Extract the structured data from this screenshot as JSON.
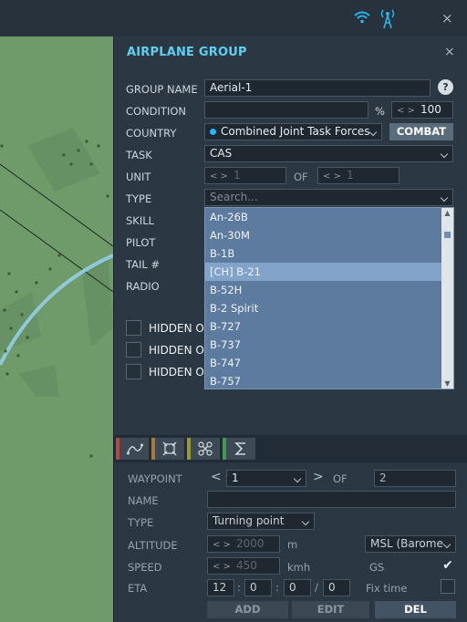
{
  "topbar": {
    "wifi_icon": "wifi-icon",
    "tower_icon": "tower-icon",
    "close": "×"
  },
  "panel": {
    "title": "AIRPLANE GROUP",
    "close": "×",
    "group_name_label": "GROUP NAME",
    "group_name_value": "Aerial-1",
    "help": "?",
    "condition_label": "CONDITION",
    "condition_value": "",
    "percent": "%",
    "condition_count": "100",
    "country_label": "COUNTRY",
    "country_value": "Combined Joint Task Forces",
    "combat_button": "COMBAT",
    "task_label": "TASK",
    "task_value": "CAS",
    "unit_label": "UNIT",
    "unit_value": "1",
    "of_label": "OF",
    "unit_of_value": "1",
    "type_label": "TYPE",
    "type_placeholder": "Search...",
    "skill_label": "SKILL",
    "pilot_label": "PILOT",
    "tail_label": "TAIL #",
    "radio_label": "RADIO",
    "type_options": [
      "An-26B",
      "An-30M",
      "B-1B",
      "[CH] B-21",
      "B-52H",
      "B-2 Spirit",
      "B-727",
      "B-737",
      "B-747",
      "B-757"
    ],
    "type_selected_index": 3,
    "hidden_labels": [
      "HIDDEN ON",
      "HIDDEN ON",
      "HIDDEN ON"
    ]
  },
  "waypoint": {
    "tabs": [
      {
        "icon": "route-icon",
        "color": "#b5473c"
      },
      {
        "icon": "target-icon",
        "color": "#a87c36"
      },
      {
        "icon": "drone-icon",
        "color": "#9a9a34"
      },
      {
        "icon": "sigma-icon",
        "color": "#3f9a52"
      }
    ],
    "waypoint_label": "WAYPOINT",
    "waypoint_value": "1",
    "of_label": "OF",
    "of_value": "2",
    "name_label": "NAME",
    "name_value": "",
    "type_label": "TYPE",
    "type_value": "Turning point",
    "altitude_label": "ALTITUDE",
    "altitude_value": "2000",
    "altitude_unit": "m",
    "altitude_ref": "MSL (Barome",
    "speed_label": "SPEED",
    "speed_value": "450",
    "speed_unit": "kmh",
    "gs_label": "GS",
    "gs_checked": "✔",
    "eta_label": "ETA",
    "eta_h": "12",
    "eta_m": "0",
    "eta_s": "0",
    "eta_f": "0",
    "colon": ":",
    "slash": "/",
    "fix_time_label": "Fix time",
    "add_button": "ADD",
    "edit_button": "EDIT",
    "del_button": "DEL"
  }
}
